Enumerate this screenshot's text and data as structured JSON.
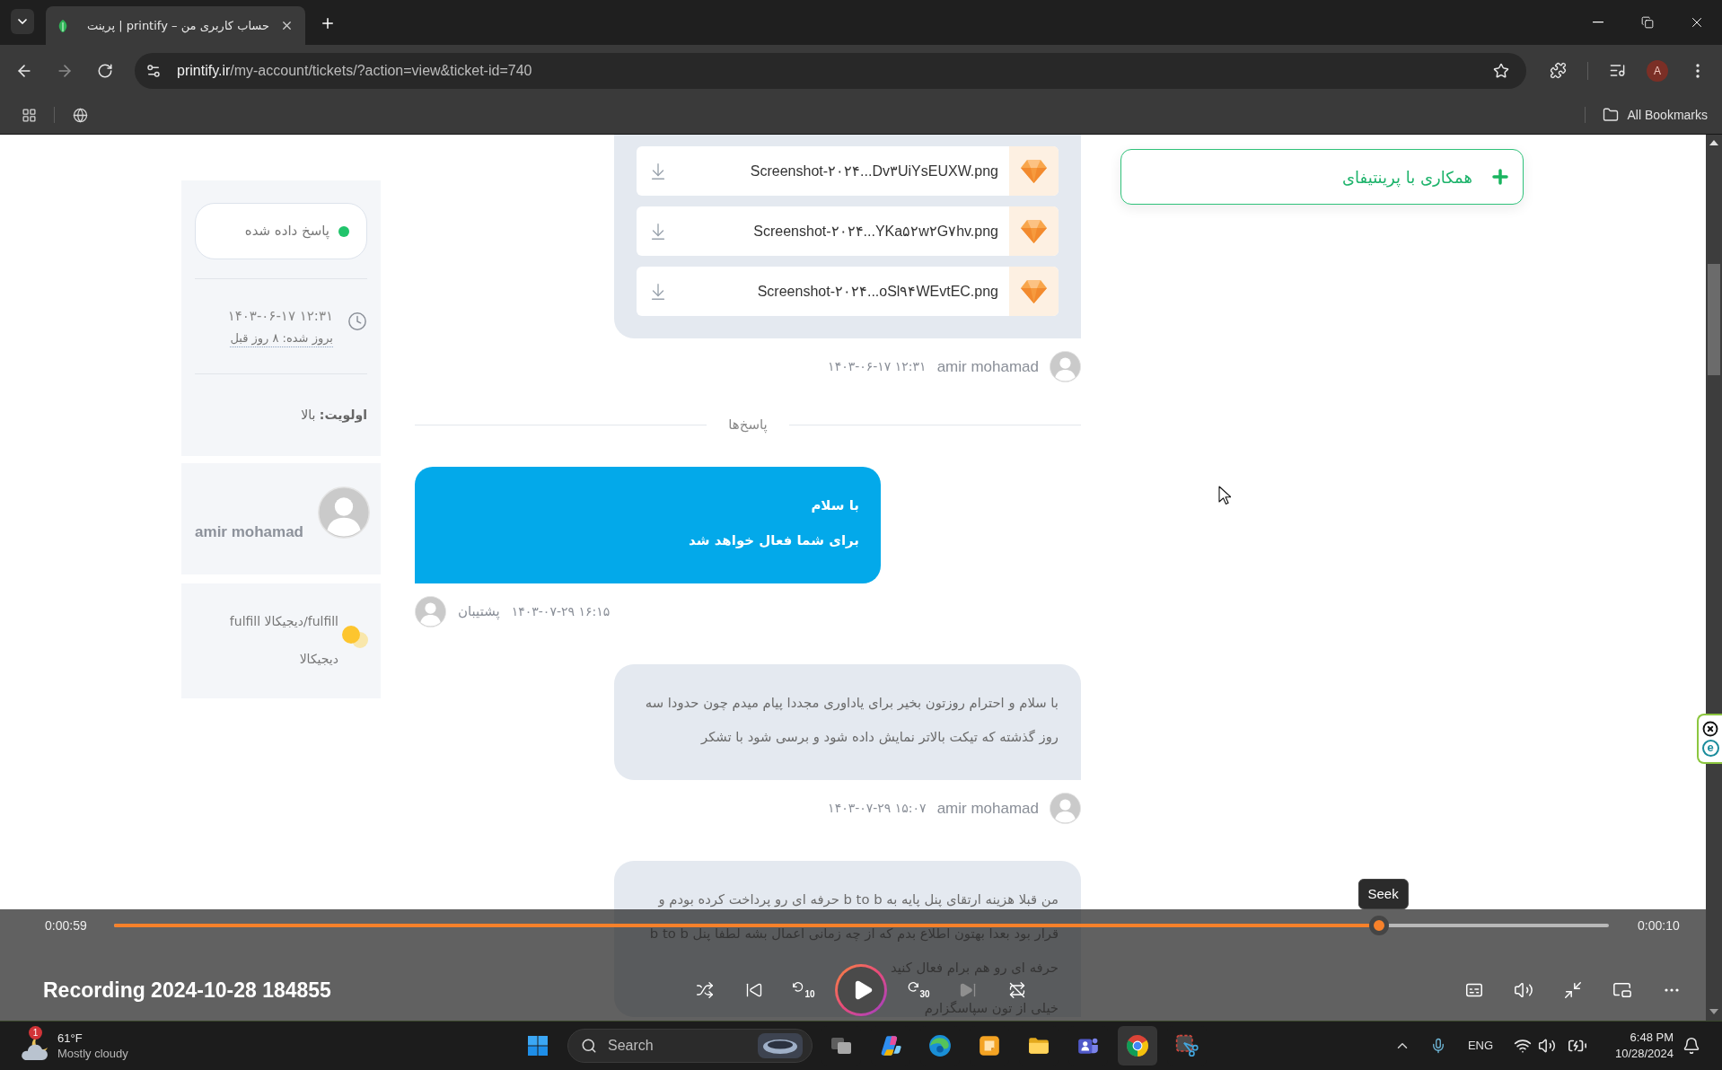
{
  "browser": {
    "tabs": [
      {
        "title": "حساب کاربری من – printify | پرینت",
        "selected": true
      }
    ],
    "url": {
      "host": "printify.ir",
      "path": "/my-account/tickets/?action=view&ticket-id=740"
    },
    "profile_initial": "A",
    "bookmarks_label": "All Bookmarks"
  },
  "ticket_info": {
    "status": {
      "label": "پاسخ داده شده",
      "color": "#21c46b"
    },
    "created": "۱۴۰۳-۰۶-۱۷ ۱۲:۳۱",
    "updated": "بروز شده: ۸ روز قبل",
    "priority": "**اولویت:** بالا"
  },
  "customer": {
    "name": "amir mohamad"
  },
  "department": {
    "label": "fulfill/دیجیکالا fulfill دیجیکالا",
    "color": "#fdc52e"
  },
  "thread": [
    {
      "kind": "customer",
      "files": [
        "Screenshot-۲۰۲۴...Dv۳UiYsEUXW.png",
        "Screenshot-۲۰۲۴...YKa۵۲w۲G۷hv.png",
        "Screenshot-۲۰۲۴...oSl۹۴WEvtEC.png"
      ],
      "author": "amir mohamad",
      "time": "۱۴۰۳-۰۶-۱۷ ۱۲:۳۱"
    },
    {
      "kind": "divider",
      "label": "پاسخ‌ها"
    },
    {
      "kind": "staff",
      "paragraphs": [
        "با سلام",
        "برای شما فعال خواهد شد"
      ],
      "author": "پشتیبان",
      "time": "۱۴۰۳-۰۷-۲۹ ۱۶:۱۵"
    },
    {
      "kind": "customer",
      "paragraphs": [
        "با سلام و احترام روزتون بخیر برای یاداوری مجددا پیام میدم چون حدودا سه روز گذشته که تیکت بالاتر نمایش داده شود و برسی شود با تشکر"
      ],
      "author": "amir mohamad",
      "time": "۱۴۰۳-۰۷-۲۹ ۱۵:۰۷"
    },
    {
      "kind": "customer",
      "paragraphs": [
        "من قبلا هزینه ارتقای پنل پایه به b to b حرفه ای رو پرداخت کرده بودم و قرار بود بعدا بهتون اطلاع بدم که از چه زمانی اعمال بشه لطفا پنل b to b حرفه ای رو هم برام فعال کنید",
        "خیلی از تون سپاسگزارم"
      ]
    }
  ],
  "partner_button": {
    "label": "همکاری با پرینتیفای"
  },
  "side_widget": {
    "label": "e"
  },
  "player": {
    "elapsed": "0:00:59",
    "remaining": "0:00:10",
    "level": 0.846,
    "tooltip": "Seek",
    "title": "Recording 2024-10-28 184855",
    "forward_label": "30",
    "rewind_label": "10",
    "controls": [
      {
        "kind": "shuffle",
        "disabled": false
      },
      {
        "kind": "previous",
        "disabled": false
      },
      {
        "kind": "rewind",
        "disabled": false
      },
      {
        "kind": "play",
        "disabled": false
      },
      {
        "kind": "forward",
        "disabled": false
      },
      {
        "kind": "next",
        "disabled": true
      },
      {
        "kind": "repeat",
        "disabled": false
      }
    ],
    "tools": [
      {
        "kind": "captions"
      },
      {
        "kind": "volume"
      },
      {
        "kind": "exit_fullscreen"
      },
      {
        "kind": "mini_player"
      },
      {
        "kind": "more"
      }
    ]
  },
  "taskbar": {
    "weather": {
      "badge": "1",
      "temperature": "61°F",
      "condition": "Mostly cloudy"
    },
    "search": {
      "label": "Search"
    },
    "apps": [
      {
        "kind": "task_view",
        "selected": false
      },
      {
        "kind": "copilot",
        "selected": false
      },
      {
        "kind": "edge",
        "selected": false
      },
      {
        "kind": "notes",
        "selected": false
      },
      {
        "kind": "files",
        "selected": false
      },
      {
        "kind": "teams",
        "selected": false
      },
      {
        "kind": "chrome",
        "selected": true
      },
      {
        "kind": "snipping",
        "selected": false
      }
    ],
    "tray": {
      "language": "ENG",
      "time": "6:48 PM",
      "date": "10/28/2024"
    }
  }
}
